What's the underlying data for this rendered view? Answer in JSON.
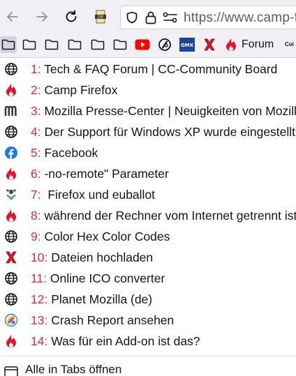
{
  "toolbar": {
    "url": "https://www.camp-firefox.de/forum/"
  },
  "bookmarks_bar": {
    "forum_label": "Forum",
    "cot_label": "Coi"
  },
  "menu": {
    "items": [
      {
        "num": "1:",
        "title": " Tech & FAQ Forum | CC-Community Board",
        "icon": "globe-icon"
      },
      {
        "num": "2:",
        "title": " Camp Firefox",
        "icon": "flame-icon"
      },
      {
        "num": "3:",
        "title": " Mozilla Presse-Center | Neuigkeiten von Mozilla",
        "icon": "mozilla-m-icon"
      },
      {
        "num": "4:",
        "title": " Der Support für Windows XP wurde eingestellt",
        "icon": "globe-icon"
      },
      {
        "num": "5:",
        "title": " Facebook",
        "icon": "facebook-icon"
      },
      {
        "num": "6:",
        "title": " -no-remote\" Parameter",
        "icon": "flame-icon"
      },
      {
        "num": "7:",
        "title": "  Firefox und euballot",
        "icon": "euballot-icon"
      },
      {
        "num": "8:",
        "title": " während der Rechner vom Internet getrennt ist",
        "icon": "flame-icon"
      },
      {
        "num": "9:",
        "title": " Color Hex Color Codes",
        "icon": "globe-icon"
      },
      {
        "num": "10:",
        "title": " Dateien hochladen",
        "icon": "x-icon"
      },
      {
        "num": "11:",
        "title": " Online ICO converter",
        "icon": "globe-icon"
      },
      {
        "num": "12:",
        "title": " Planet Mozilla (de)",
        "icon": "globe-icon"
      },
      {
        "num": "13:",
        "title": " Crash Report ansehen",
        "icon": "crash-report-icon"
      },
      {
        "num": "14:",
        "title": " Was für ein Add-on ist das?",
        "icon": "flame-icon"
      }
    ],
    "open_all_label": "Alle in Tabs öffnen"
  },
  "colors": {
    "number_red": "#e22850",
    "flame_red": "#e8112d",
    "toolbar_bg": "#f0f0f4"
  }
}
